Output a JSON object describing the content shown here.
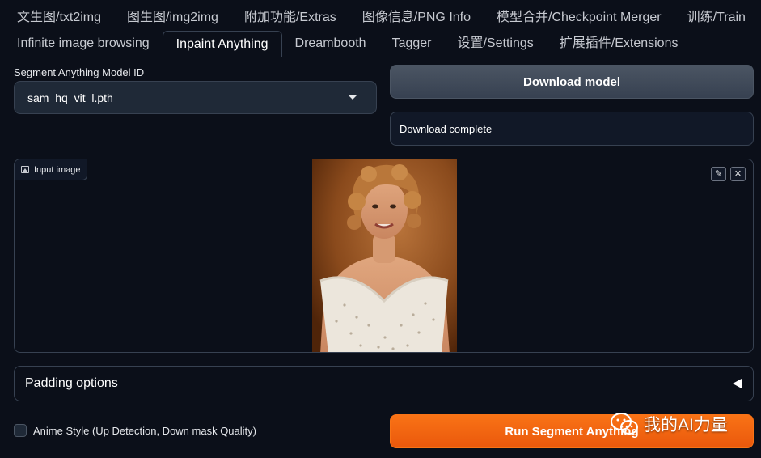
{
  "tabs": {
    "row1": [
      {
        "label": "文生图/txt2img"
      },
      {
        "label": "图生图/img2img"
      },
      {
        "label": "附加功能/Extras"
      },
      {
        "label": "图像信息/PNG Info"
      },
      {
        "label": "模型合并/Checkpoint Merger"
      },
      {
        "label": "训练/Train"
      }
    ],
    "row2": [
      {
        "label": "Infinite image browsing"
      },
      {
        "label": "Inpaint Anything"
      },
      {
        "label": "Dreambooth"
      },
      {
        "label": "Tagger"
      },
      {
        "label": "设置/Settings"
      },
      {
        "label": "扩展插件/Extensions"
      }
    ],
    "active": "Inpaint Anything"
  },
  "model": {
    "label": "Segment Anything Model ID",
    "selected": "sam_hq_vit_l.pth"
  },
  "download": {
    "button_label": "Download model",
    "status": "Download complete"
  },
  "image_panel": {
    "label": "Input image",
    "label_icon": "image-icon",
    "tools": [
      "edit-icon",
      "close-icon"
    ]
  },
  "padding": {
    "label": "Padding options",
    "arrow": "◀"
  },
  "anime": {
    "label": "Anime Style (Up Detection, Down mask Quality)",
    "checked": false
  },
  "run": {
    "button_label": "Run Segment Anything"
  },
  "watermark": {
    "text": "我的AI力量"
  },
  "colors": {
    "background": "#0b0f19",
    "accent_orange": "#f97316",
    "panel_border": "#374151"
  }
}
